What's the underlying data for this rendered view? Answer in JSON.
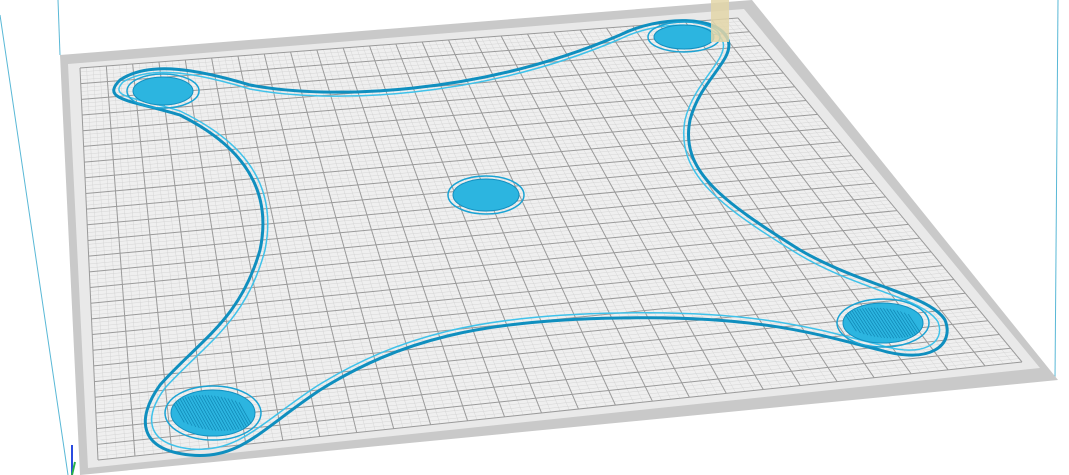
{
  "viewport": {
    "background_color": "#ffffff",
    "bed_color": "#e6e6e6",
    "bed_border_color": "#c7c7c7",
    "grid_major_color": "#9a9a9a",
    "grid_minor_color": "#cfcfcf",
    "frame_color": "#59b8d6",
    "print_color": "#1aa3d4",
    "print_fill_color": "#2cb5e0",
    "nozzle_marker_color": "#e3d6a8"
  },
  "bed": {
    "grid_divisions": 25
  },
  "print_layer": {
    "pads": [
      {
        "name": "pad-top-left"
      },
      {
        "name": "pad-top-right"
      },
      {
        "name": "pad-center"
      },
      {
        "name": "pad-bottom-right"
      },
      {
        "name": "pad-bottom-left"
      }
    ]
  }
}
